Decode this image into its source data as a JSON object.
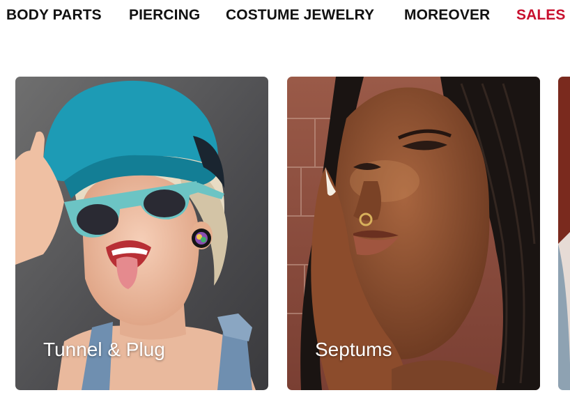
{
  "nav": {
    "items": [
      {
        "label": "BODY PARTS"
      },
      {
        "label": "PIERCING"
      },
      {
        "label": "COSTUME JEWELRY"
      },
      {
        "label": "MOREOVER"
      },
      {
        "label": "SALES"
      }
    ],
    "text_color": "#111111",
    "sale_color": "#c8102e"
  },
  "categories": [
    {
      "label": "Tunnel & Plug",
      "image": "woman-with-teal-cap-and-sunglasses-photo"
    },
    {
      "label": "Septums",
      "image": "woman-with-braids-and-septum-ring-photo"
    },
    {
      "label": "",
      "image": "partially-visible-next-card-photo"
    }
  ]
}
